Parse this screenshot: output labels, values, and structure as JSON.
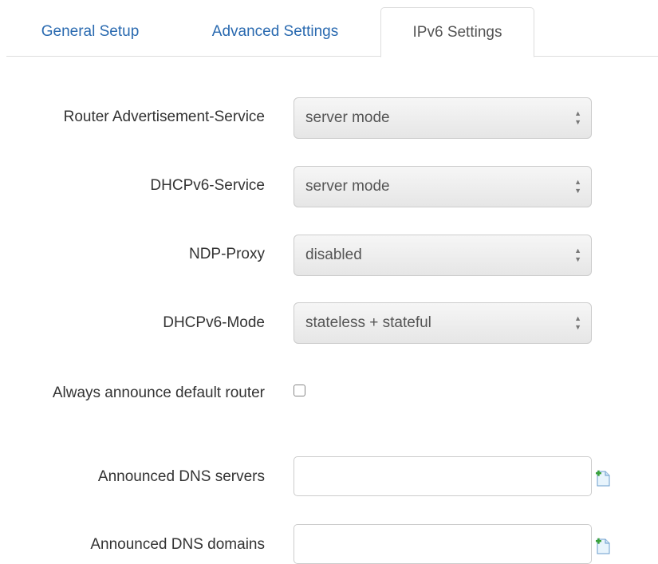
{
  "tabs": [
    {
      "label": "General Setup",
      "active": false
    },
    {
      "label": "Advanced Settings",
      "active": false
    },
    {
      "label": "IPv6 Settings",
      "active": true
    }
  ],
  "fields": {
    "ra_service": {
      "label": "Router Advertisement-Service",
      "value": "server mode"
    },
    "dhcpv6_service": {
      "label": "DHCPv6-Service",
      "value": "server mode"
    },
    "ndp_proxy": {
      "label": "NDP-Proxy",
      "value": "disabled"
    },
    "dhcpv6_mode": {
      "label": "DHCPv6-Mode",
      "value": "stateless + stateful"
    },
    "default_router": {
      "label": "Always announce default router",
      "checked": false
    },
    "dns_servers": {
      "label": "Announced DNS servers",
      "value": "",
      "add_icon": "add-entry-icon"
    },
    "dns_domains": {
      "label": "Announced DNS domains",
      "value": "",
      "add_icon": "add-entry-icon"
    }
  },
  "colors": {
    "link": "#2a6ab0",
    "active_tab_text": "#555555",
    "label_text": "#333333",
    "select_bg": "#eeeeee",
    "border": "#cccccc"
  }
}
